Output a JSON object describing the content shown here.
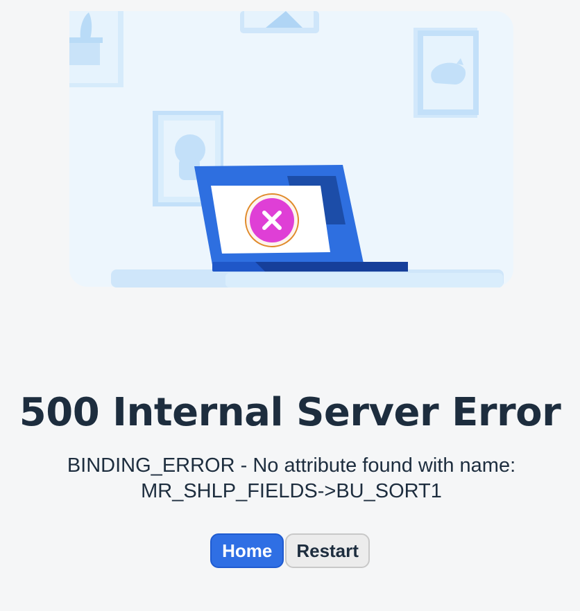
{
  "error": {
    "title": "500 Internal Server Error",
    "message": "BINDING_ERROR - No attribute found with name: MR_SHLP_FIELDS->BU_SORT1"
  },
  "actions": {
    "home_label": "Home",
    "restart_label": "Restart"
  },
  "illustration": {
    "icon": "error-x-icon",
    "colors": {
      "background": "#eaf4fd",
      "laptop": "#2e6fe0",
      "error_badge": "#df3fd6",
      "badge_ring": "#e08a2a"
    }
  }
}
